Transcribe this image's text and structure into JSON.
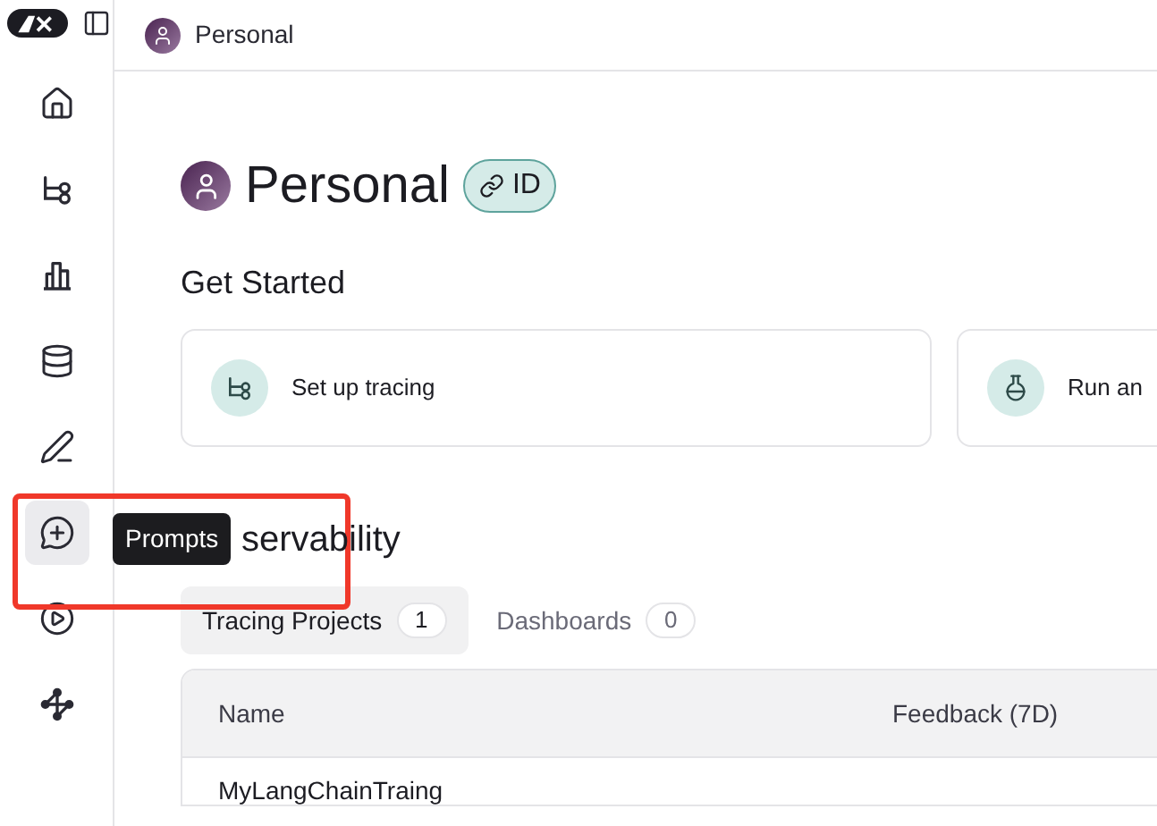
{
  "breadcrumb": {
    "label": "Personal"
  },
  "sidebar": {
    "items": [
      {
        "kind": "home",
        "selected": false
      },
      {
        "kind": "tracing",
        "selected": false
      },
      {
        "kind": "monitor",
        "selected": false
      },
      {
        "kind": "datasets",
        "selected": false
      },
      {
        "kind": "annotation",
        "selected": false
      },
      {
        "kind": "prompts",
        "selected": true
      },
      {
        "kind": "play",
        "selected": false
      },
      {
        "kind": "deploy",
        "selected": false
      }
    ]
  },
  "tooltip": "Prompts",
  "page": {
    "title": "Personal",
    "id_badge": "ID"
  },
  "get_started": {
    "title": "Get Started",
    "cards": [
      {
        "kind": "tracing",
        "label": "Set up tracing"
      },
      {
        "kind": "flask",
        "label": "Run an"
      }
    ]
  },
  "observability": {
    "title": "servability",
    "tabs": [
      {
        "label": "Tracing Projects",
        "count": "1",
        "selected": true
      },
      {
        "label": "Dashboards",
        "count": "0",
        "selected": false
      }
    ]
  },
  "table": {
    "columns": [
      "Name",
      "Feedback (7D)"
    ],
    "rows": [
      [
        "MyLangChainTraing"
      ]
    ]
  }
}
